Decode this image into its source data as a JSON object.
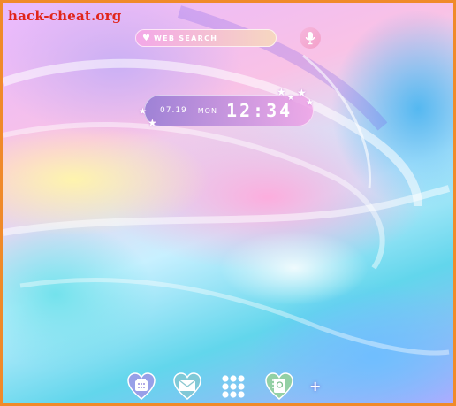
{
  "watermark": "hack-cheat.org",
  "search": {
    "label": "WEB SEARCH",
    "heart": "♥",
    "icon": "heart-icon"
  },
  "mic": {
    "icon": "microphone-icon"
  },
  "clock": {
    "date": "07.19",
    "day": "MON",
    "time": "12:34"
  },
  "dock": {
    "items": [
      {
        "name": "phone",
        "icon": "phone-icon"
      },
      {
        "name": "mail",
        "icon": "mail-icon"
      },
      {
        "name": "apps",
        "icon": "app-drawer-icon"
      },
      {
        "name": "contacts",
        "icon": "contacts-icon"
      }
    ],
    "add_icon": "plus-icon",
    "plus": "+"
  },
  "colors": {
    "border": "#f08a2a",
    "watermark": "#e1251b",
    "accent": "#f3a7e8"
  }
}
